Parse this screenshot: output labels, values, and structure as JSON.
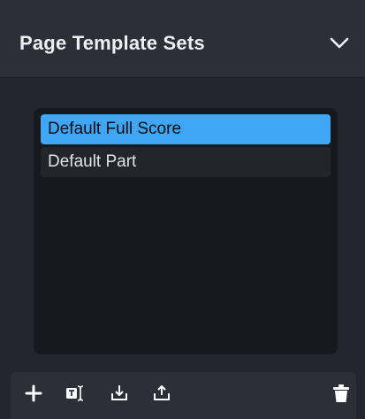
{
  "panel": {
    "title": "Page Template Sets",
    "items": [
      {
        "label": "Default Full Score",
        "selected": true
      },
      {
        "label": "Default Part",
        "selected": false
      }
    ]
  },
  "icons": {
    "header_toggle": "chevron-down-icon",
    "toolbar": [
      "plus-icon",
      "rename-icon",
      "import-icon",
      "export-icon",
      "trash-icon"
    ]
  },
  "colors": {
    "selected": "#3ea6f5",
    "header_bg": "#2c2f38",
    "list_bg": "#17191e"
  }
}
